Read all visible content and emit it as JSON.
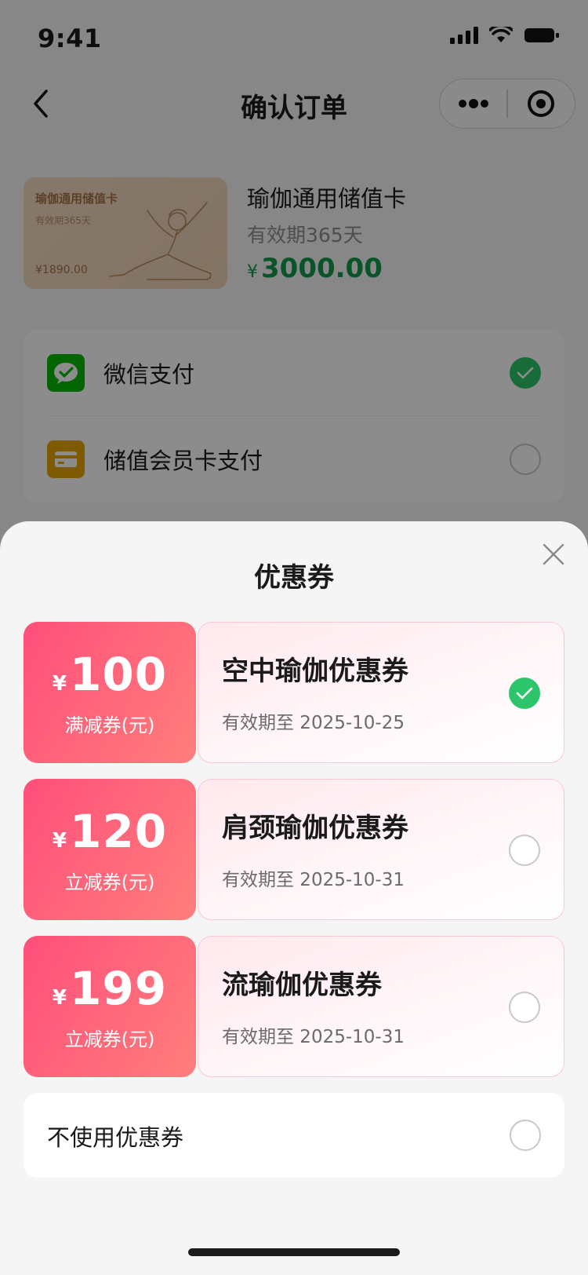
{
  "status_bar": {
    "time": "9:41"
  },
  "nav": {
    "title": "确认订单"
  },
  "product": {
    "card": {
      "title": "瑜伽通用储值卡",
      "subtitle": "有效期365天",
      "price": "¥1890.00"
    },
    "name": "瑜伽通用储值卡",
    "validity": "有效期365天",
    "currency": "¥",
    "price": "3000.00"
  },
  "payment": {
    "options": [
      {
        "label": "微信支付",
        "icon": "wechat-pay-icon",
        "selected": true
      },
      {
        "label": "储值会员卡支付",
        "icon": "member-card-icon",
        "selected": false
      }
    ]
  },
  "sheet": {
    "title": "优惠券",
    "coupons": [
      {
        "currency": "¥",
        "amount": "100",
        "type": "满减券(元)",
        "name": "空中瑜伽优惠券",
        "expire": "有效期至 2025-10-25",
        "selected": true
      },
      {
        "currency": "¥",
        "amount": "120",
        "type": "立减券(元)",
        "name": "肩颈瑜伽优惠券",
        "expire": "有效期至 2025-10-31",
        "selected": false
      },
      {
        "currency": "¥",
        "amount": "199",
        "type": "立减券(元)",
        "name": "流瑜伽优惠券",
        "expire": "有效期至 2025-10-31",
        "selected": false
      }
    ],
    "no_coupon": {
      "label": "不使用优惠券",
      "selected": false
    }
  },
  "colors": {
    "accent_green": "#2dc56b",
    "price_green": "#149a4e",
    "coupon_pink": "#ff4f7b",
    "wechat_green": "#09bb07",
    "card_gold": "#e6a700"
  }
}
